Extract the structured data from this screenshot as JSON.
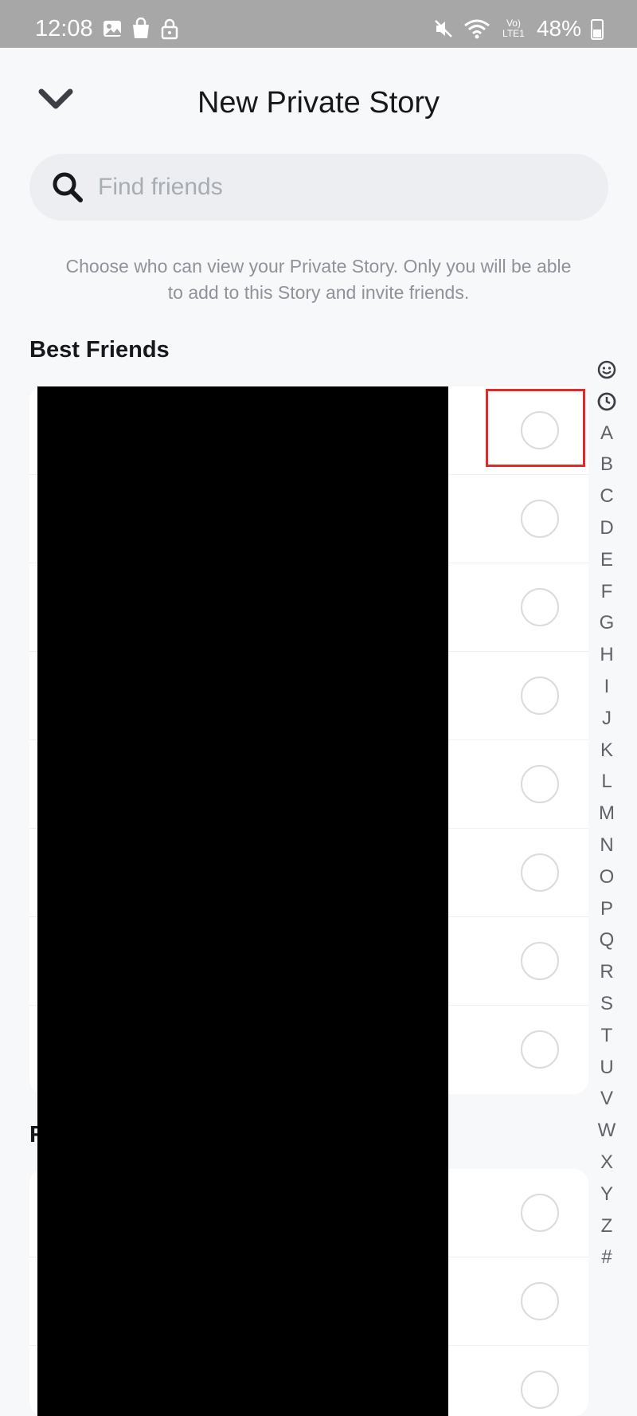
{
  "status_bar": {
    "time": "12:08",
    "battery": "48%",
    "left_icons": [
      "gallery-icon",
      "shopping-bag-icon",
      "lock-icon"
    ],
    "right_icons": [
      "mute-icon",
      "wifi-icon",
      "volte-lte-icon",
      "battery-icon"
    ],
    "network_label": "Vo) LTE1"
  },
  "header": {
    "title": "New Private Story",
    "back_icon": "chevron-down-icon"
  },
  "search": {
    "placeholder": "Find friends",
    "value": ""
  },
  "description": "Choose who can view your Private Story. Only you will be able to add to this Story and invite friends.",
  "sections": [
    {
      "title": "Best Friends",
      "rows": [
        {
          "selected": false
        },
        {
          "selected": false
        },
        {
          "selected": false
        },
        {
          "selected": false
        },
        {
          "selected": false
        },
        {
          "selected": false
        },
        {
          "selected": false
        },
        {
          "selected": false
        }
      ]
    },
    {
      "title": "R",
      "rows": [
        {
          "selected": false
        },
        {
          "selected": false
        },
        {
          "selected": false
        }
      ]
    }
  ],
  "alphabet_index": {
    "icons": [
      "smiley-icon",
      "clock-icon"
    ],
    "letters": [
      "A",
      "B",
      "C",
      "D",
      "E",
      "F",
      "G",
      "H",
      "I",
      "J",
      "K",
      "L",
      "M",
      "N",
      "O",
      "P",
      "Q",
      "R",
      "S",
      "T",
      "U",
      "V",
      "W",
      "X",
      "Y",
      "Z",
      "#"
    ]
  },
  "colors": {
    "highlight_box": "#e02b2b",
    "background": "#f7f8fa",
    "status_bar": "#a7a7a7"
  }
}
